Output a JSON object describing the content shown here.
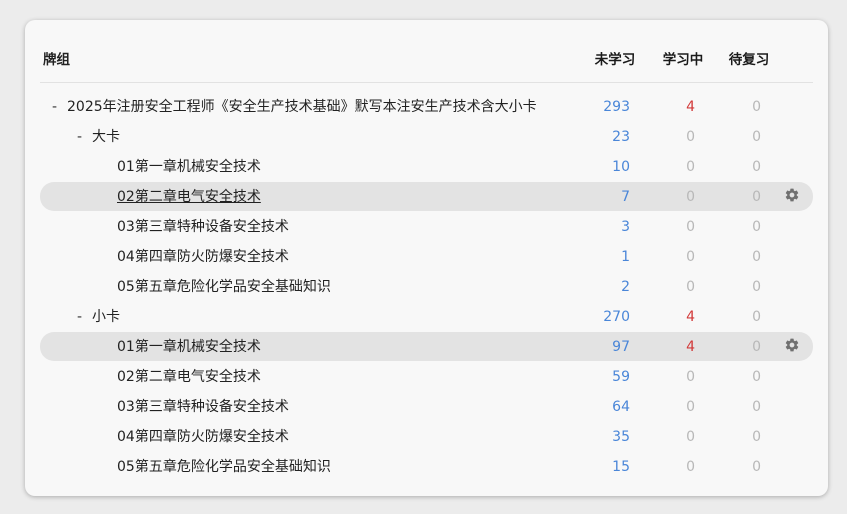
{
  "header": {
    "deck": "牌组",
    "new": "未学习",
    "learning": "学习中",
    "review": "待复习"
  },
  "colors": {
    "new": "#4a86d8",
    "learning": "#d23a3a",
    "zero": "#b8b8b8",
    "highlight": "#e3e3e3"
  },
  "rows": [
    {
      "toggle": "-",
      "name": "2025年注册安全工程师《安全生产技术基础》默写本注安生产技术含大小卡",
      "new": "293",
      "learning": "4",
      "review": "0",
      "level": 0
    },
    {
      "toggle": "-",
      "name": "大卡",
      "new": "23",
      "learning": "0",
      "review": "0",
      "level": 1
    },
    {
      "toggle": "",
      "name": "01第一章机械安全技术",
      "new": "10",
      "learning": "0",
      "review": "0",
      "level": 2
    },
    {
      "toggle": "",
      "name": "02第二章电气安全技术",
      "new": "7",
      "learning": "0",
      "review": "0",
      "level": 2,
      "current": true,
      "highlight": true,
      "gear": "gear-icon"
    },
    {
      "toggle": "",
      "name": "03第三章特种设备安全技术",
      "new": "3",
      "learning": "0",
      "review": "0",
      "level": 2
    },
    {
      "toggle": "",
      "name": "04第四章防火防爆安全技术",
      "new": "1",
      "learning": "0",
      "review": "0",
      "level": 2
    },
    {
      "toggle": "",
      "name": "05第五章危险化学品安全基础知识",
      "new": "2",
      "learning": "0",
      "review": "0",
      "level": 2
    },
    {
      "toggle": "-",
      "name": "小卡",
      "new": "270",
      "learning": "4",
      "review": "0",
      "level": 1
    },
    {
      "toggle": "",
      "name": "01第一章机械安全技术",
      "new": "97",
      "learning": "4",
      "review": "0",
      "level": 2,
      "highlight": true,
      "gear": "gear-icon"
    },
    {
      "toggle": "",
      "name": "02第二章电气安全技术",
      "new": "59",
      "learning": "0",
      "review": "0",
      "level": 2
    },
    {
      "toggle": "",
      "name": "03第三章特种设备安全技术",
      "new": "64",
      "learning": "0",
      "review": "0",
      "level": 2
    },
    {
      "toggle": "",
      "name": "04第四章防火防爆安全技术",
      "new": "35",
      "learning": "0",
      "review": "0",
      "level": 2
    },
    {
      "toggle": "",
      "name": "05第五章危险化学品安全基础知识",
      "new": "15",
      "learning": "0",
      "review": "0",
      "level": 2
    }
  ]
}
